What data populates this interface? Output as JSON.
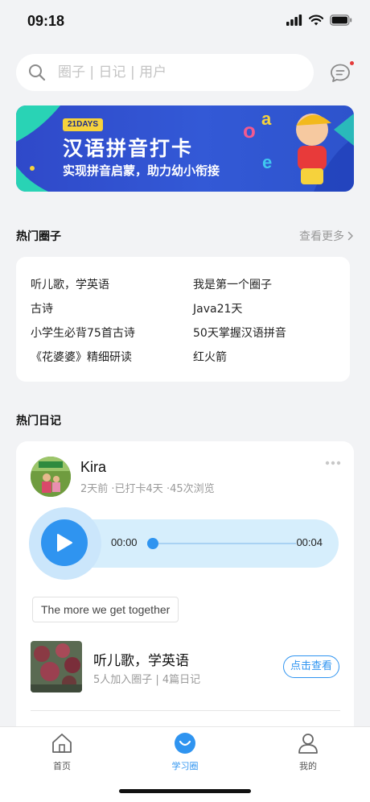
{
  "status_bar": {
    "time": "09:18"
  },
  "search": {
    "placeholder": "圈子 | 日记 | 用户"
  },
  "banner": {
    "tag": "21DAYS",
    "title": "汉语拼音打卡",
    "subtitle": "实现拼音启蒙，助力幼小衔接"
  },
  "hot_circles": {
    "title": "热门圈子",
    "more_label": "查看更多",
    "items": [
      "听儿歌，学英语",
      "我是第一个圈子",
      "古诗",
      "Java21天",
      "小学生必背75首古诗",
      "50天掌握汉语拼音",
      "《花婆婆》精细研读",
      "红火箭"
    ]
  },
  "hot_diary": {
    "title": "热门日记",
    "post": {
      "user_name": "Kira",
      "meta": "2天前 ·已打卡4天 ·45次浏览",
      "audio_current": "00:00",
      "audio_total": "00:04",
      "audio_progress": 0,
      "text_tag": "The more we get together",
      "group_title": "听儿歌，学英语",
      "group_meta": "5人加入圈子 | 4篇日记",
      "view_button": "点击查看"
    }
  },
  "tabbar": {
    "tabs": [
      {
        "label": "首页",
        "icon": "home-icon",
        "active": false
      },
      {
        "label": "学习圈",
        "icon": "smile-icon",
        "active": true
      },
      {
        "label": "我的",
        "icon": "person-icon",
        "active": false
      }
    ]
  },
  "colors": {
    "accent": "#2f94f0",
    "background": "#f2f3f5",
    "banner": "#3359d6",
    "notification_dot": "#e43a3a"
  }
}
